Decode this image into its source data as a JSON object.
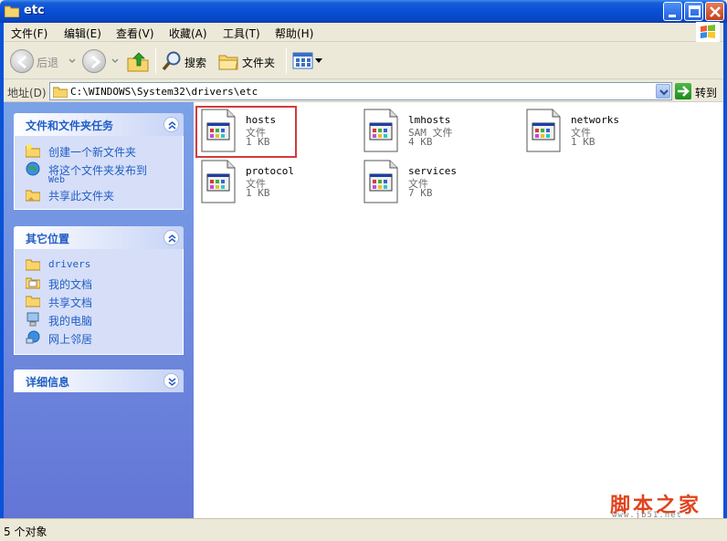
{
  "window": {
    "title": "etc"
  },
  "menu": [
    {
      "label": "文件(F)"
    },
    {
      "label": "编辑(E)"
    },
    {
      "label": "查看(V)"
    },
    {
      "label": "收藏(A)"
    },
    {
      "label": "工具(T)"
    },
    {
      "label": "帮助(H)"
    }
  ],
  "toolbar": {
    "back_label": "后退",
    "search_label": "搜索",
    "folders_label": "文件夹"
  },
  "address": {
    "label": "地址(D)",
    "path": "C:\\WINDOWS\\System32\\drivers\\etc",
    "go_label": "转到"
  },
  "panels": {
    "tasks": {
      "title": "文件和文件夹任务",
      "items": [
        {
          "label": "创建一个新文件夹",
          "icon": "new-folder-icon"
        },
        {
          "label": "将这个文件夹发布到",
          "label2": "Web",
          "icon": "publish-web-icon"
        },
        {
          "label": "共享此文件夹",
          "icon": "share-folder-icon"
        }
      ]
    },
    "places": {
      "title": "其它位置",
      "items": [
        {
          "label": "drivers",
          "icon": "folder-icon"
        },
        {
          "label": "我的文档",
          "icon": "my-documents-icon"
        },
        {
          "label": "共享文档",
          "icon": "shared-folder-icon"
        },
        {
          "label": "我的电脑",
          "icon": "my-computer-icon"
        },
        {
          "label": "网上邻居",
          "icon": "network-icon"
        }
      ]
    },
    "details": {
      "title": "详细信息"
    }
  },
  "files": [
    {
      "name": "hosts",
      "type": "文件",
      "size": "1 KB",
      "highlighted": true
    },
    {
      "name": "lmhosts",
      "type": "SAM 文件",
      "size": "4 KB"
    },
    {
      "name": "networks",
      "type": "文件",
      "size": "1 KB"
    },
    {
      "name": "protocol",
      "type": "文件",
      "size": "1 KB"
    },
    {
      "name": "services",
      "type": "文件",
      "size": "7 KB"
    }
  ],
  "status": {
    "text": "5 个对象"
  },
  "watermark": {
    "text": "脚本之家",
    "url": "www.jb51.net"
  },
  "colors": {
    "titlebar": "#0a52d8",
    "task_link": "#215dc6",
    "highlight_border": "#d23b3b",
    "watermark": "#e1431e"
  }
}
